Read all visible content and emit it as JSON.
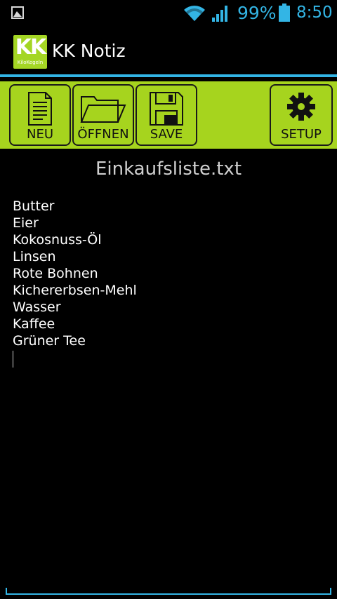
{
  "status_bar": {
    "battery_percent": "99%",
    "time": "8:50",
    "icons": [
      "picture-icon",
      "wifi-icon",
      "signal-icon",
      "battery-icon"
    ],
    "accent_color": "#33b5e5"
  },
  "action_bar": {
    "logo_text": "KK",
    "logo_subtext": "KiloKegeln",
    "title": "KK Notiz"
  },
  "toolbar": {
    "background_color": "#a6d41e",
    "buttons": [
      {
        "label": "NEU",
        "icon": "document-icon"
      },
      {
        "label": "ÖFFNEN",
        "icon": "folder-icon"
      },
      {
        "label": "SAVE",
        "icon": "floppy-disk-icon"
      },
      {
        "label": "SETUP",
        "icon": "gear-icon"
      }
    ]
  },
  "editor": {
    "file_name": "Einkaufsliste.txt",
    "lines": [
      "Butter",
      "Eier",
      "Kokosnuss-Öl",
      "Linsen",
      "Rote Bohnen",
      "Kichererbsen-Mehl",
      "Wasser",
      "Kaffee",
      "Grüner Tee"
    ]
  }
}
